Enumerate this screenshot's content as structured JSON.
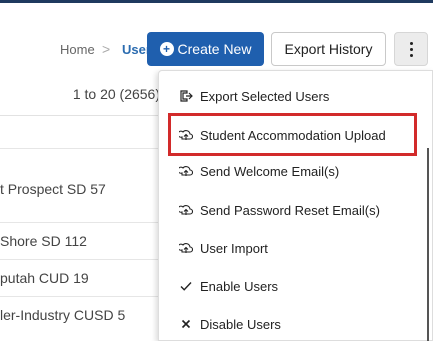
{
  "breadcrumb": {
    "home": "Home",
    "separator": ">",
    "current": "Users"
  },
  "toolbar": {
    "create_label": "Create New",
    "export_history_label": "Export History"
  },
  "table": {
    "pagination": "1 to 20 (2656)",
    "rows": [
      "t Prospect SD 57",
      "Shore SD 112",
      "putah CUD 19",
      "ler-Industry CUSD 5"
    ]
  },
  "menu": {
    "items": [
      {
        "label": "Export Selected Users",
        "icon": "export-icon"
      },
      {
        "label": "Student Accommodation Upload",
        "icon": "upload-icon"
      },
      {
        "label": "Send Welcome Email(s)",
        "icon": "upload-icon"
      },
      {
        "label": "Send Password Reset Email(s)",
        "icon": "upload-icon"
      },
      {
        "label": "User Import",
        "icon": "upload-icon"
      },
      {
        "label": "Enable Users",
        "icon": "check-icon"
      },
      {
        "label": "Disable Users",
        "icon": "x-icon"
      }
    ]
  },
  "colors": {
    "primary": "#1f5fae",
    "highlight": "#d22a2a",
    "top_rule": "#1f3a5f"
  }
}
